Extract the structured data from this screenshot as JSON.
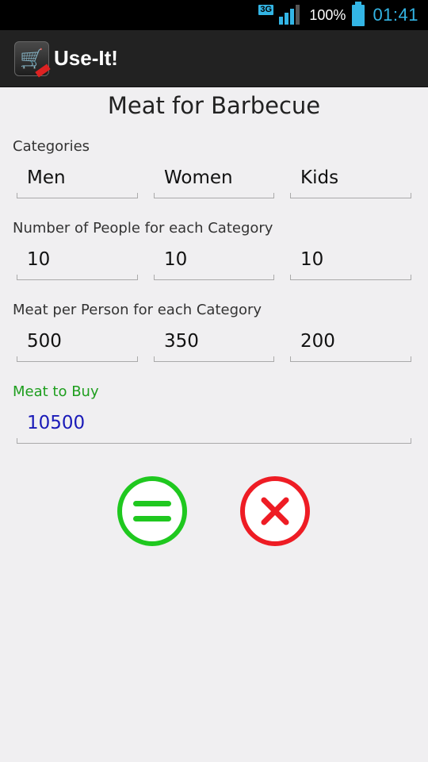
{
  "status_bar": {
    "network_type": "3G",
    "battery_percent": "100%",
    "battery_level": 1.0,
    "time": "01:41",
    "accent_color": "#33b5e5"
  },
  "action_bar": {
    "app_title": "Use-It!",
    "app_icon": "shopping-cart-icon"
  },
  "form": {
    "title": "Meat for Barbecue",
    "categories_label": "Categories",
    "categories": [
      "Men",
      "Women",
      "Kids"
    ],
    "people_label": "Number of People for each Category",
    "people": [
      "10",
      "10",
      "10"
    ],
    "meat_label": "Meat per Person for each Category",
    "meat_per_person": [
      "500",
      "350",
      "200"
    ],
    "result_label": "Meat to Buy",
    "result_value": "10500"
  },
  "buttons": {
    "calculate_icon": "equals-icon",
    "calculate_color": "#1fc81f",
    "clear_icon": "close-icon",
    "clear_color": "#ee1c24"
  }
}
